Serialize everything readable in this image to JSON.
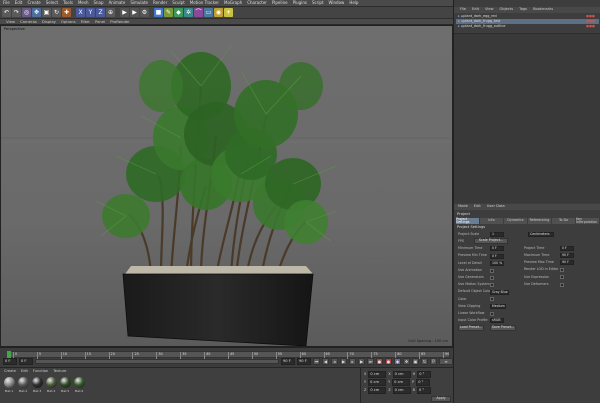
{
  "menubar": [
    "File",
    "Edit",
    "Create",
    "Select",
    "Tools",
    "Mesh",
    "Snap",
    "Animate",
    "Simulate",
    "Render",
    "Sculpt",
    "Motion Tracker",
    "MoGraph",
    "Character",
    "Pipeline",
    "Plugins",
    "Script",
    "Window",
    "Help"
  ],
  "viewport": {
    "menu": [
      "View",
      "Cameras",
      "Display",
      "Options",
      "Filter",
      "Panel",
      "ProRender"
    ],
    "label": "Perspective",
    "grid_spacing": "Grid Spacing : 100 cm"
  },
  "timeline": {
    "ticks": [
      "0",
      "5",
      "10",
      "15",
      "20",
      "25",
      "30",
      "35",
      "40",
      "45",
      "50",
      "55",
      "60",
      "65",
      "70",
      "75",
      "80",
      "85",
      "90"
    ],
    "end_frame": "0 F",
    "start_field": "0 F",
    "current_field": "0 F",
    "end_field": "90 F",
    "max_field": "90 F"
  },
  "materials": {
    "menu": [
      "Create",
      "Edit",
      "Function",
      "Texture"
    ],
    "items": [
      {
        "label": "Mat.1",
        "color": "#8a8a8a"
      },
      {
        "label": "Mat.2",
        "color": "#5a5a5a"
      },
      {
        "label": "Mat.3",
        "color": "#2e2e2e"
      },
      {
        "label": "Mat.4",
        "color": "#4d5a3a"
      },
      {
        "label": "Mat.5",
        "color": "#2f4a27"
      },
      {
        "label": "Mat.6",
        "color": "#3a5a2c"
      }
    ]
  },
  "coords": {
    "rows": [
      {
        "a": "X",
        "v1": "0 cm",
        "b": "X",
        "v2": "0 cm",
        "c": "H",
        "v3": "0 °"
      },
      {
        "a": "Y",
        "v1": "0 cm",
        "b": "Y",
        "v2": "0 cm",
        "c": "P",
        "v3": "0 °"
      },
      {
        "a": "Z",
        "v1": "0 cm",
        "b": "Z",
        "v2": "0 cm",
        "c": "B",
        "v3": "0 °"
      }
    ],
    "apply": "Apply"
  },
  "object_manager": {
    "menu": [
      "File",
      "Edit",
      "View",
      "Objects",
      "Tags",
      "Bookmarks"
    ],
    "rows": [
      {
        "name": "plant_dark_egg_red",
        "selected": false
      },
      {
        "name": "plant_dark_frugg_test",
        "selected": true
      },
      {
        "name": "plant_dark_frugg_outline",
        "selected": false
      }
    ]
  },
  "attributes": {
    "menu": [
      "Mode",
      "Edit",
      "User Data"
    ],
    "title": "Project",
    "tabs": [
      "Project Settings",
      "Info",
      "Dynamics",
      "Referencing",
      "To Do",
      "Key Interpolation"
    ],
    "section": "Project Settings",
    "rows": [
      {
        "label": "Project Scale",
        "value": "1"
      },
      {
        "label": "FPS",
        "value": "30"
      },
      {
        "label": "Minimum Time",
        "value": "0 F"
      },
      {
        "label": "Preview Min Time",
        "value": "0 F"
      },
      {
        "label": "Level of Detail",
        "value": "100 %"
      },
      {
        "label": "Use Animation",
        "value": ""
      },
      {
        "label": "Use Generators",
        "value": ""
      },
      {
        "label": "Use Motion System",
        "value": ""
      },
      {
        "label": "Default Object Color",
        "value": "Gray Blue"
      },
      {
        "label": "Color",
        "value": ""
      },
      {
        "label": "View Clipping",
        "value": "Medium"
      },
      {
        "label": "Linear Workflow",
        "value": ""
      },
      {
        "label": "Input Color Profile",
        "value": "sRGB"
      }
    ],
    "right_rows": [
      {
        "label": "Project Time",
        "value": "0 F"
      },
      {
        "label": "Maximum Time",
        "value": "90 F"
      },
      {
        "label": "Preview Max Time",
        "value": "90 F"
      },
      {
        "label": "Render LOD in Editor",
        "value": ""
      },
      {
        "label": "Use Expression",
        "value": ""
      },
      {
        "label": "Use Deformers",
        "value": ""
      }
    ],
    "scale_unit": "Centimeters",
    "scale_button": "Scale Project...",
    "load_button": "Load Preset...",
    "save_button": "Save Preset..."
  }
}
